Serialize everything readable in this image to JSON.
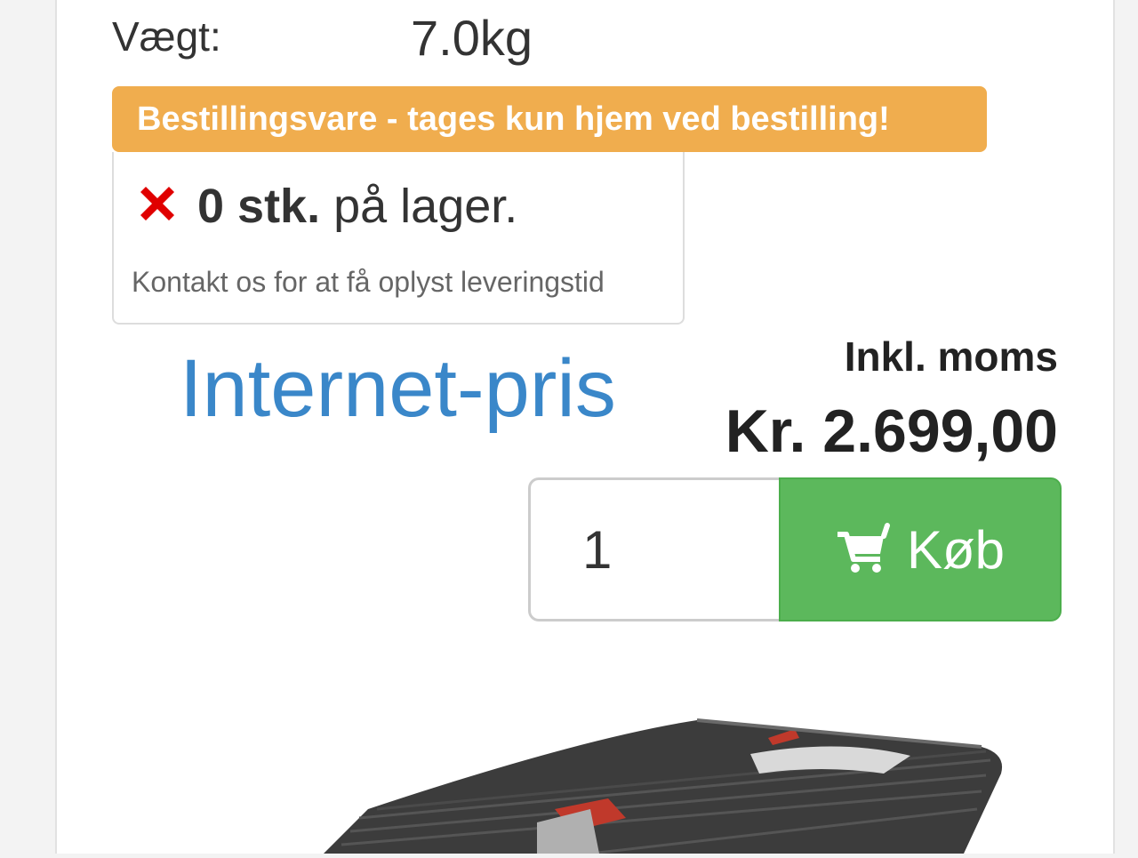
{
  "product": {
    "weight_label": "Vægt:",
    "weight_value": "7.0kg"
  },
  "banner": {
    "text": "Bestillingsvare - tages kun hjem ved bestilling!"
  },
  "stock": {
    "count": "0 stk.",
    "suffix": " på lager.",
    "hint": "Kontakt os for at få oplyst leveringstid"
  },
  "pricing": {
    "internet_label": "Internet-pris",
    "vat_label": "Inkl. moms",
    "price": "Kr. 2.699,00"
  },
  "purchase": {
    "quantity": "1",
    "buy_label": "Køb"
  },
  "colors": {
    "banner": "#f0ad4e",
    "buy_button": "#5cb85c",
    "internet_price": "#3a87c9",
    "out_of_stock": "#e00000"
  }
}
